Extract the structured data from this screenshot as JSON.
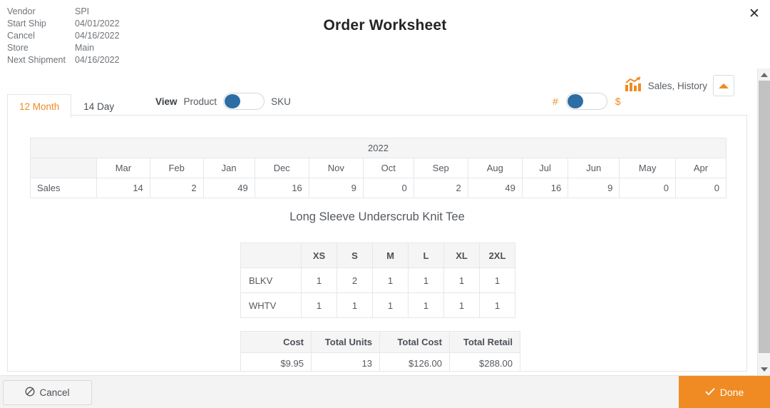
{
  "header": {
    "title": "Order Worksheet",
    "close_icon": "close-icon",
    "meta": [
      {
        "label": "Vendor",
        "value": "SPI"
      },
      {
        "label": "Start Ship",
        "value": "04/01/2022"
      },
      {
        "label": "Cancel",
        "value": "04/16/2022"
      },
      {
        "label": "Store",
        "value": "Main"
      },
      {
        "label": "Next Shipment",
        "value": "04/16/2022"
      }
    ]
  },
  "toolbar": {
    "view_label": "View",
    "view_left_option": "Product",
    "view_right_option": "SKU",
    "view_toggle_position": "left",
    "unit_left_option": "#",
    "unit_right_option": "$",
    "unit_toggle_position": "left",
    "history_label": "Sales, History",
    "history_icon": "bar-chart-icon",
    "collapse_icon": "caret-up-icon",
    "accent_color": "#ef8b22",
    "toggle_knob_color": "#2c6ea4"
  },
  "tabs": [
    {
      "label": "12 Month",
      "active": true
    },
    {
      "label": "14 Day",
      "active": false
    }
  ],
  "sales_table": {
    "year": "2022",
    "row_label": "Sales",
    "months": [
      "Mar",
      "Feb",
      "Jan",
      "Dec",
      "Nov",
      "Oct",
      "Sep",
      "Aug",
      "Jul",
      "Jun",
      "May",
      "Apr"
    ],
    "values": [
      "14",
      "2",
      "49",
      "16",
      "9",
      "0",
      "2",
      "49",
      "16",
      "9",
      "0",
      "0"
    ]
  },
  "product": {
    "title": "Long Sleeve Underscrub Knit Tee",
    "sizes": [
      "XS",
      "S",
      "M",
      "L",
      "XL",
      "2XL"
    ],
    "rows": [
      {
        "color": "BLKV",
        "quantities": [
          "1",
          "2",
          "1",
          "1",
          "1",
          "1"
        ]
      },
      {
        "color": "WHTV",
        "quantities": [
          "1",
          "1",
          "1",
          "1",
          "1",
          "1"
        ]
      }
    ]
  },
  "cost_summary": {
    "headers": [
      "Cost",
      "Total Units",
      "Total Cost",
      "Total Retail"
    ],
    "values": [
      "$9.95",
      "13",
      "$126.00",
      "$288.00"
    ]
  },
  "scrollbar": {
    "up_icon": "scroll-up-arrow-icon",
    "down_icon": "scroll-down-arrow-icon"
  },
  "footer": {
    "cancel_label": "Cancel",
    "cancel_icon": "ban-circle-icon",
    "done_label": "Done",
    "done_icon": "check-icon"
  },
  "chart_data": {
    "type": "table",
    "title": "Sales, History — 12 Month",
    "categories": [
      "Mar",
      "Feb",
      "Jan",
      "Dec",
      "Nov",
      "Oct",
      "Sep",
      "Aug",
      "Jul",
      "Jun",
      "May",
      "Apr"
    ],
    "values": [
      14,
      2,
      49,
      16,
      9,
      0,
      2,
      49,
      16,
      9,
      0,
      0
    ],
    "series": [
      {
        "name": "Sales",
        "values": [
          14,
          2,
          49,
          16,
          9,
          0,
          2,
          49,
          16,
          9,
          0,
          0
        ]
      }
    ],
    "xlabel": "2022",
    "ylabel": "Sales",
    "ylim": [
      0,
      49
    ]
  }
}
